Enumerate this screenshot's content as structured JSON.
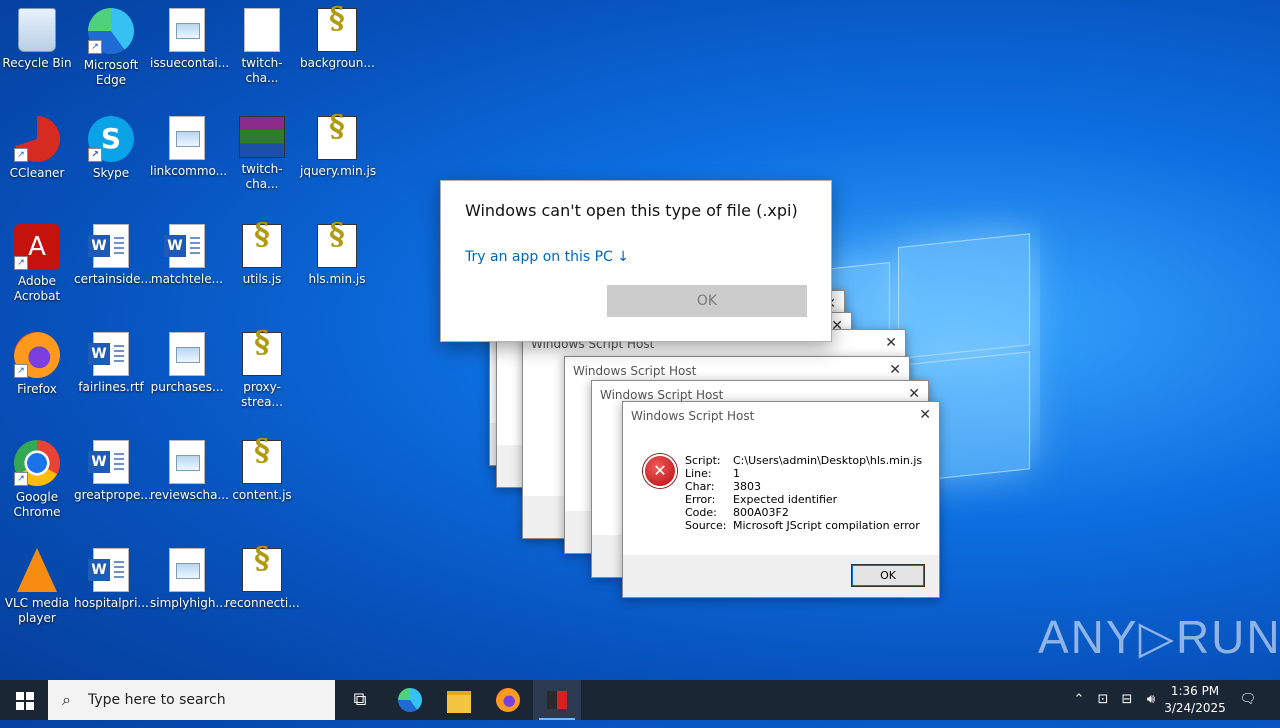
{
  "desktop": {
    "icons": [
      {
        "label": "Recycle Bin"
      },
      {
        "label": "Microsoft Edge"
      },
      {
        "label": "issuecontai..."
      },
      {
        "label": "twitch-cha..."
      },
      {
        "label": "backgroun..."
      },
      {
        "label": "CCleaner"
      },
      {
        "label": "Skype"
      },
      {
        "label": "linkcommo..."
      },
      {
        "label": "twitch-cha..."
      },
      {
        "label": "jquery.min.js"
      },
      {
        "label": "Adobe Acrobat"
      },
      {
        "label": "certainside..."
      },
      {
        "label": "matchtele..."
      },
      {
        "label": "utils.js"
      },
      {
        "label": "hls.min.js"
      },
      {
        "label": "Firefox"
      },
      {
        "label": "fairlines.rtf"
      },
      {
        "label": "purchases..."
      },
      {
        "label": "proxy-strea..."
      },
      {
        "label": "Google Chrome"
      },
      {
        "label": "greatprope..."
      },
      {
        "label": "reviewscha..."
      },
      {
        "label": "content.js"
      },
      {
        "label": "VLC media player"
      },
      {
        "label": "hospitalpri..."
      },
      {
        "label": "simplyhigh..."
      },
      {
        "label": "reconnecti..."
      }
    ]
  },
  "open_with_dialog": {
    "heading": "Windows can't open this type of file (.xpi)",
    "link": "Try an app on this PC ↓",
    "ok_label": "OK"
  },
  "wsh_dialog": {
    "title": "Windows Script Host",
    "close": "✕",
    "fields": [
      {
        "key": "Script:",
        "value": "C:\\Users\\admin\\Desktop\\hls.min.js"
      },
      {
        "key": "Line:",
        "value": "1"
      },
      {
        "key": "Char:",
        "value": "3803"
      },
      {
        "key": "Error:",
        "value": "Expected identifier"
      },
      {
        "key": "Code:",
        "value": "800A03F2"
      },
      {
        "key": "Source:",
        "value": "Microsoft JScript compilation error"
      }
    ],
    "ok_label": "OK"
  },
  "watermark": "ANY▷RUN",
  "taskbar": {
    "search_placeholder": "Type here to search",
    "time": "1:36 PM",
    "date": "3/24/2025"
  }
}
